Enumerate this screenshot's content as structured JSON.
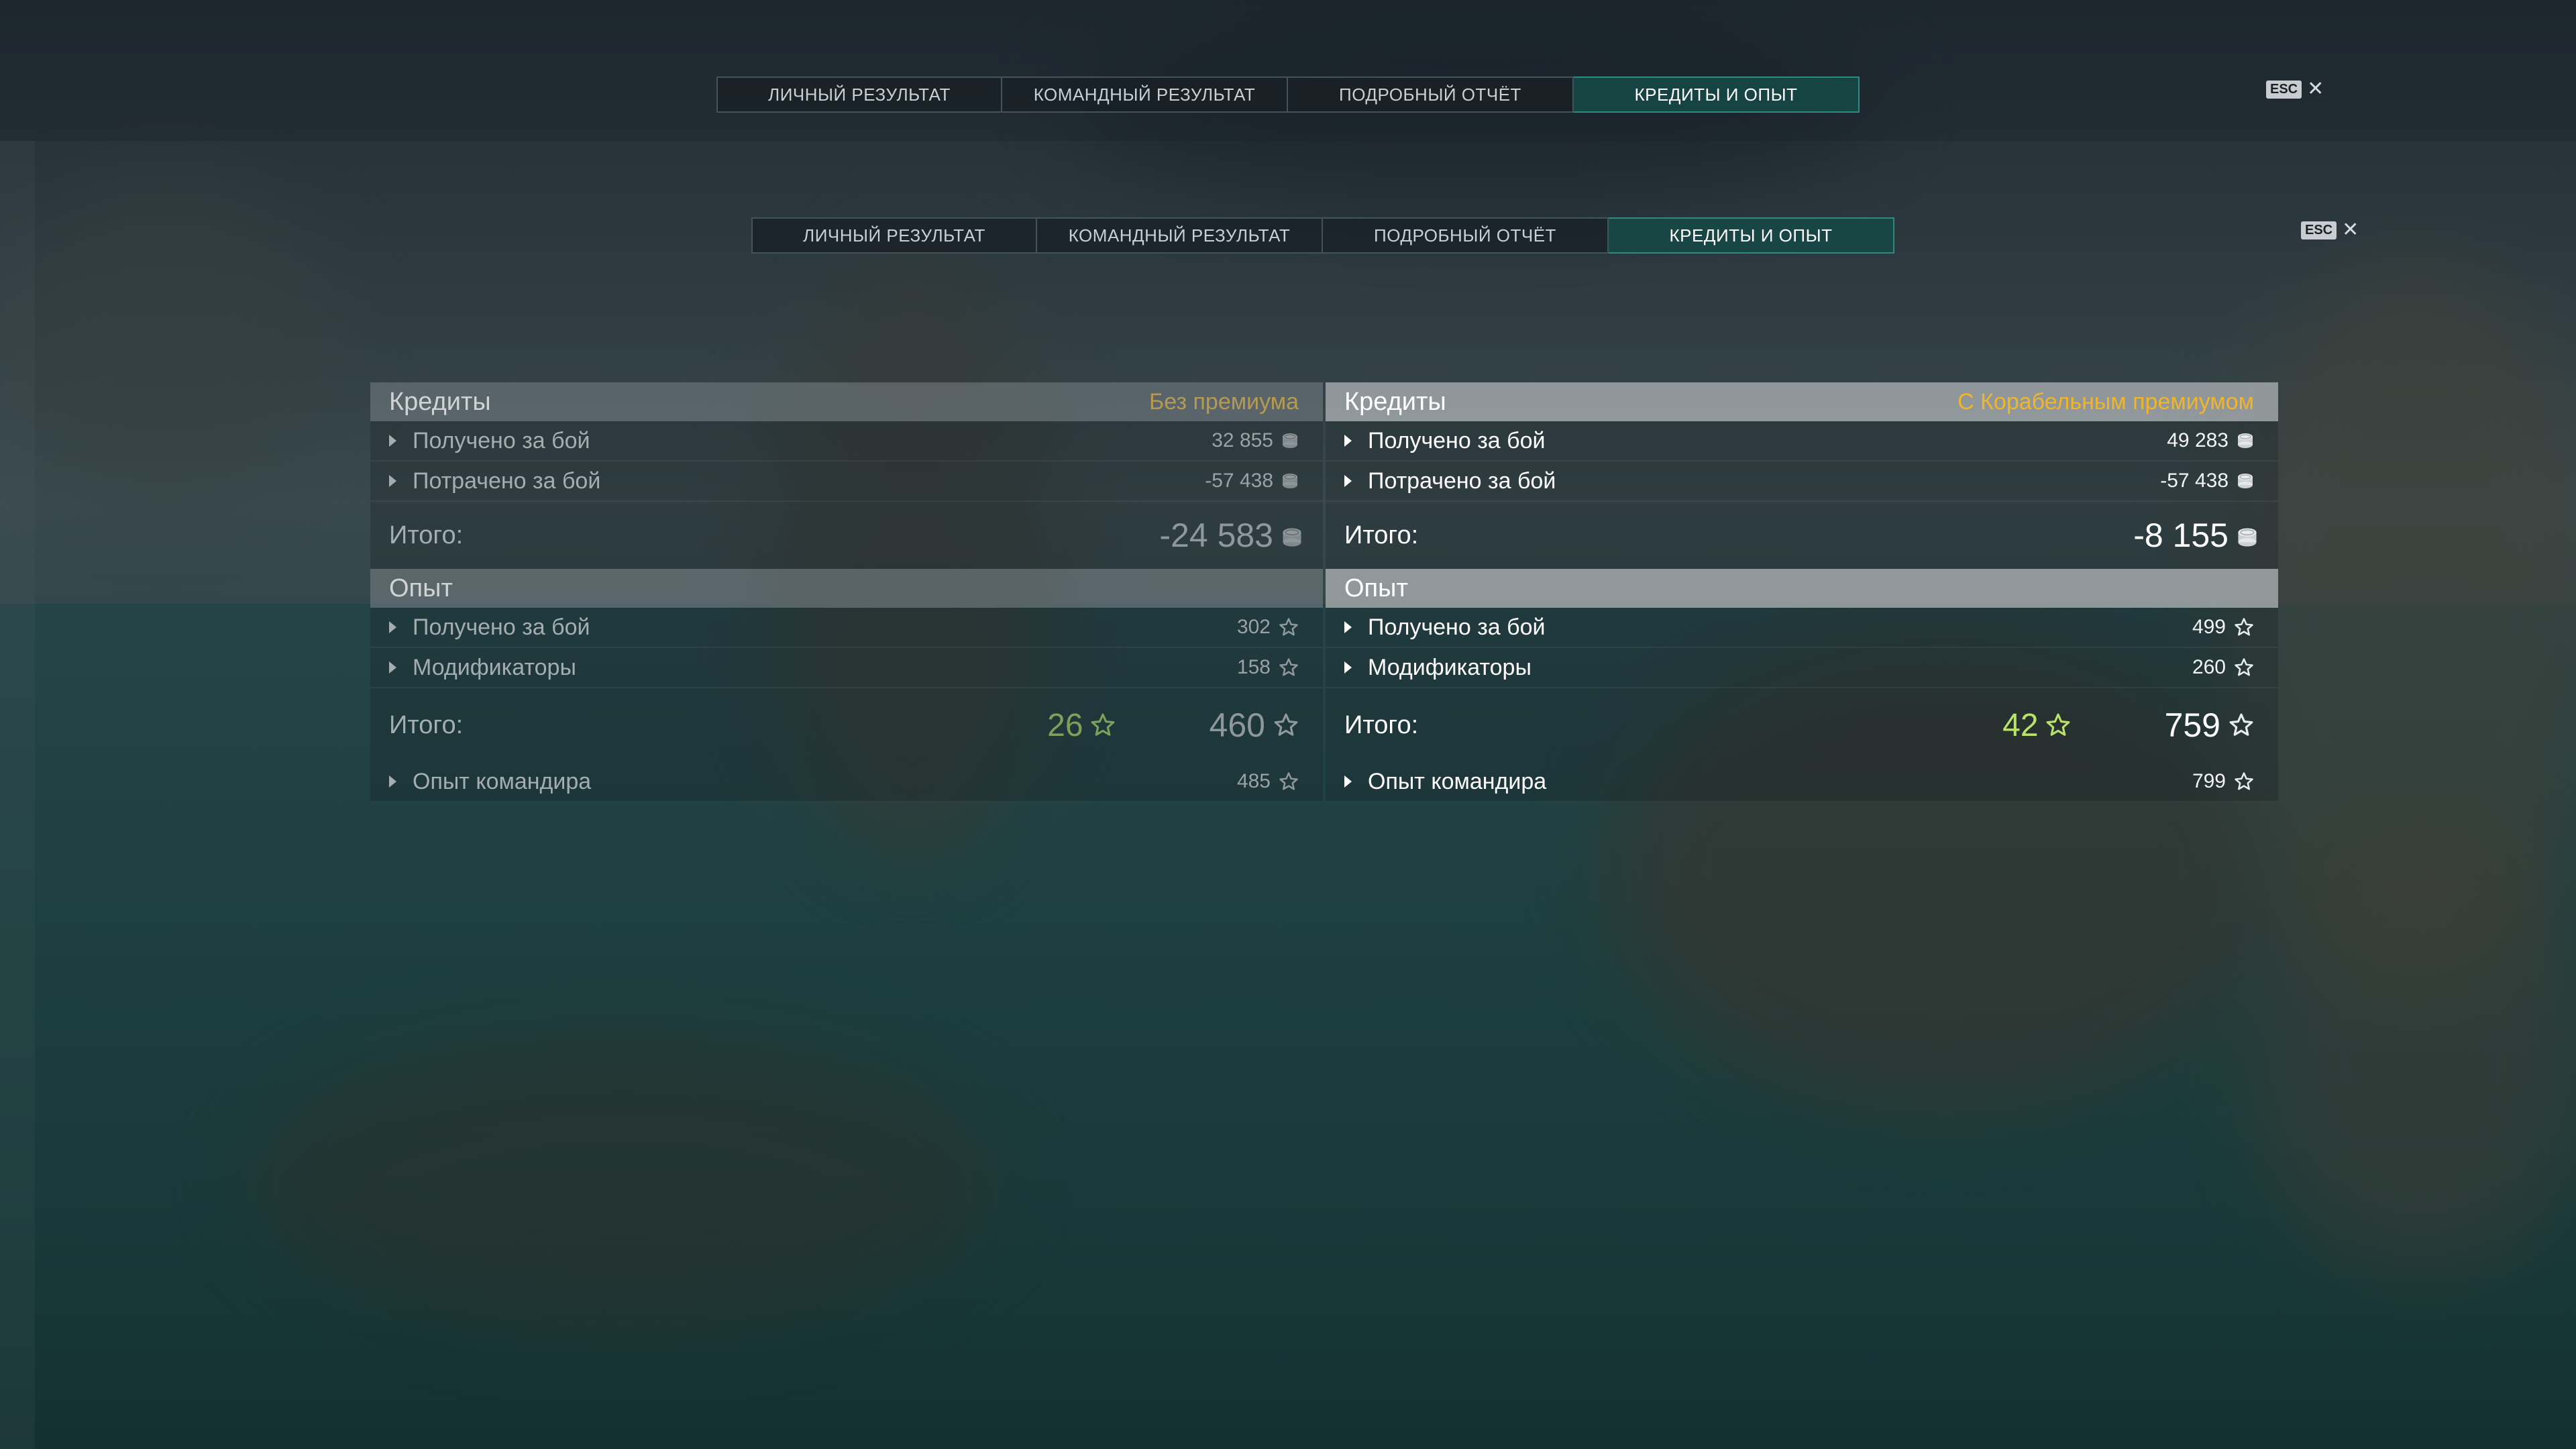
{
  "tabs": {
    "items": [
      "ЛИЧНЫЙ РЕЗУЛЬТАТ",
      "КОМАНДНЫЙ РЕЗУЛЬТАТ",
      "ПОДРОБНЫЙ ОТЧЁТ",
      "КРЕДИТЫ И ОПЫТ"
    ],
    "active_index": 3
  },
  "esc": {
    "key": "ESC",
    "close": "✕"
  },
  "left": {
    "credits": {
      "title": "Кредиты",
      "premium": "Без премиума",
      "rows": [
        {
          "label": "Получено за бой",
          "value": "32 855"
        },
        {
          "label": "Потрачено за бой",
          "value": "-57 438"
        }
      ],
      "total_label": "Итого:",
      "total_value": "-24 583"
    },
    "exp": {
      "title": "Опыт",
      "rows": [
        {
          "label": "Получено за бой",
          "value": "302"
        },
        {
          "label": "Модификаторы",
          "value": "158"
        }
      ],
      "total_label": "Итого:",
      "bonus_value": "26",
      "total_value": "460",
      "commander_label": "Опыт командира",
      "commander_value": "485"
    }
  },
  "right": {
    "credits": {
      "title": "Кредиты",
      "premium": "С Корабельным премиумом",
      "rows": [
        {
          "label": "Получено за бой",
          "value": "49 283"
        },
        {
          "label": "Потрачено за бой",
          "value": "-57 438"
        }
      ],
      "total_label": "Итого:",
      "total_value": "-8 155"
    },
    "exp": {
      "title": "Опыт",
      "rows": [
        {
          "label": "Получено за бой",
          "value": "499"
        },
        {
          "label": "Модификаторы",
          "value": "260"
        }
      ],
      "total_label": "Итого:",
      "bonus_value": "42",
      "total_value": "759",
      "commander_label": "Опыт командира",
      "commander_value": "799"
    }
  },
  "icons": {
    "credit": "credit-coin-icon",
    "xp": "xp-star-icon",
    "expand": "expand-arrow-icon"
  },
  "colors": {
    "active_tab": "#164846",
    "premium_none": "#b59a52",
    "premium_ship": "#f0b52a",
    "bonus_xp": "#b8e36a"
  }
}
